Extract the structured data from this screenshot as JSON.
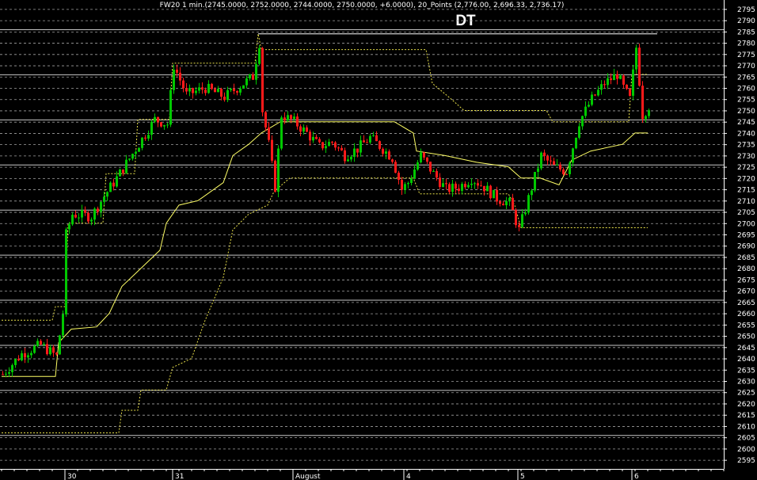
{
  "header": {
    "info": "FW20 1 min.(2745.0000, 2752.0000, 2744.0000, 2750.0000, +6.0000), 20_Points (2,776.00, 2,696.33, 2,736.17)"
  },
  "annotation": {
    "text": "DT",
    "level": 2784
  },
  "colors": {
    "background": "#000000",
    "up": "#00c800",
    "down": "#ff1a1a",
    "upper_band": "#e8e04a",
    "mid_band": "#ffff66",
    "grid_solid": "#c8c8c8",
    "grid_dotted": "#a0a0a0",
    "axis_text": "#ffffff",
    "dt_line": "#ffffff"
  },
  "chart_data": {
    "type": "candlestick",
    "instrument": "FW20",
    "timeframe": "1 min.",
    "last_bar": {
      "open": 2745,
      "high": 2752,
      "low": 2744,
      "close": 2750,
      "change": 6
    },
    "indicator": {
      "name": "20_Points",
      "upper": 2776.0,
      "lower": 2696.33,
      "middle": 2736.17
    },
    "ylim": [
      2591,
      2799
    ],
    "y_ticks": [
      2595,
      2600,
      2605,
      2610,
      2615,
      2620,
      2625,
      2630,
      2635,
      2640,
      2645,
      2650,
      2655,
      2660,
      2665,
      2670,
      2675,
      2680,
      2685,
      2690,
      2695,
      2700,
      2705,
      2710,
      2715,
      2720,
      2725,
      2730,
      2735,
      2740,
      2745,
      2750,
      2755,
      2760,
      2765,
      2770,
      2775,
      2780,
      2785,
      2790,
      2795
    ],
    "solid_grid_levels": [
      2606,
      2626,
      2646,
      2666,
      2686,
      2706,
      2726,
      2746,
      2766,
      2786
    ],
    "x_labels": [
      "30",
      "31",
      "August",
      "4",
      "5",
      "6"
    ],
    "x_label_bar_index": [
      20,
      54,
      92,
      127,
      163,
      199
    ],
    "bars": 208,
    "close_path": [
      [
        0,
        2633
      ],
      [
        6,
        2642
      ],
      [
        12,
        2646
      ],
      [
        17,
        2641
      ],
      [
        19,
        2660
      ],
      [
        20,
        2695
      ],
      [
        22,
        2704
      ],
      [
        28,
        2703
      ],
      [
        32,
        2712
      ],
      [
        36,
        2720
      ],
      [
        42,
        2733
      ],
      [
        48,
        2746
      ],
      [
        52,
        2744
      ],
      [
        54,
        2770
      ],
      [
        58,
        2757
      ],
      [
        64,
        2760
      ],
      [
        70,
        2756
      ],
      [
        74,
        2760
      ],
      [
        79,
        2765
      ],
      [
        81,
        2780
      ],
      [
        82,
        2750
      ],
      [
        84,
        2735
      ],
      [
        86,
        2716
      ],
      [
        88,
        2748
      ],
      [
        92,
        2745
      ],
      [
        96,
        2740
      ],
      [
        100,
        2734
      ],
      [
        104,
        2736
      ],
      [
        108,
        2730
      ],
      [
        112,
        2733
      ],
      [
        116,
        2738
      ],
      [
        120,
        2733
      ],
      [
        123,
        2729
      ],
      [
        126,
        2715
      ],
      [
        128,
        2718
      ],
      [
        132,
        2730
      ],
      [
        136,
        2722
      ],
      [
        140,
        2715
      ],
      [
        144,
        2716
      ],
      [
        148,
        2720
      ],
      [
        152,
        2716
      ],
      [
        156,
        2711
      ],
      [
        160,
        2709
      ],
      [
        163,
        2697
      ],
      [
        166,
        2711
      ],
      [
        170,
        2730
      ],
      [
        174,
        2725
      ],
      [
        178,
        2723
      ],
      [
        182,
        2745
      ],
      [
        186,
        2755
      ],
      [
        190,
        2762
      ],
      [
        194,
        2766
      ],
      [
        196,
        2760
      ],
      [
        198,
        2755
      ],
      [
        200,
        2778
      ],
      [
        202,
        2748
      ],
      [
        204,
        2752
      ]
    ],
    "upper_band": [
      [
        0,
        2657
      ],
      [
        16,
        2657
      ],
      [
        17,
        2663
      ],
      [
        20,
        2663
      ],
      [
        21,
        2700
      ],
      [
        32,
        2700
      ],
      [
        33,
        2722
      ],
      [
        42,
        2722
      ],
      [
        43,
        2746
      ],
      [
        53,
        2746
      ],
      [
        54,
        2771
      ],
      [
        80,
        2771
      ],
      [
        81,
        2784
      ],
      [
        82,
        2777
      ],
      [
        134,
        2777
      ],
      [
        136,
        2762
      ],
      [
        142,
        2755
      ],
      [
        146,
        2750
      ],
      [
        172,
        2750
      ],
      [
        174,
        2745
      ],
      [
        198,
        2745
      ],
      [
        199,
        2766
      ],
      [
        204,
        2766
      ]
    ],
    "lower_band": [
      [
        0,
        2607
      ],
      [
        37,
        2607
      ],
      [
        38,
        2617
      ],
      [
        43,
        2617
      ],
      [
        44,
        2626
      ],
      [
        52,
        2626
      ],
      [
        54,
        2636
      ],
      [
        60,
        2640
      ],
      [
        64,
        2656
      ],
      [
        70,
        2676
      ],
      [
        73,
        2697
      ],
      [
        78,
        2704
      ],
      [
        84,
        2708
      ],
      [
        86,
        2714
      ],
      [
        91,
        2720
      ],
      [
        130,
        2720
      ],
      [
        132,
        2713
      ],
      [
        160,
        2713
      ],
      [
        162,
        2708
      ],
      [
        164,
        2698
      ],
      [
        204,
        2698
      ]
    ],
    "mid_band": [
      [
        0,
        2632
      ],
      [
        17,
        2632
      ],
      [
        18,
        2647
      ],
      [
        22,
        2653
      ],
      [
        30,
        2654
      ],
      [
        34,
        2660
      ],
      [
        38,
        2672
      ],
      [
        44,
        2680
      ],
      [
        50,
        2688
      ],
      [
        52,
        2700
      ],
      [
        56,
        2708
      ],
      [
        62,
        2710
      ],
      [
        70,
        2718
      ],
      [
        73,
        2730
      ],
      [
        78,
        2735
      ],
      [
        82,
        2740
      ],
      [
        88,
        2745
      ],
      [
        124,
        2745
      ],
      [
        130,
        2740
      ],
      [
        131,
        2732
      ],
      [
        140,
        2730
      ],
      [
        150,
        2727
      ],
      [
        160,
        2725
      ],
      [
        164,
        2720
      ],
      [
        170,
        2720
      ],
      [
        176,
        2717
      ],
      [
        180,
        2728
      ],
      [
        186,
        2732
      ],
      [
        196,
        2735
      ],
      [
        200,
        2740
      ],
      [
        204,
        2740
      ]
    ]
  }
}
